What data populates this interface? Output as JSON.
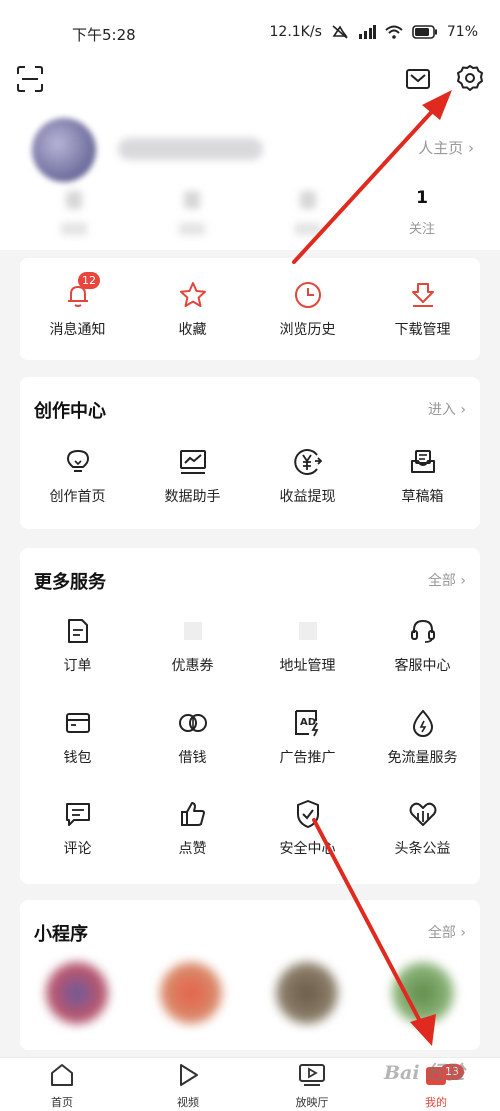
{
  "status_bar": {
    "time": "下午5:28",
    "speed": "12.1K/s",
    "battery": "71%"
  },
  "header": {
    "icons": [
      "scan-icon",
      "mail-icon",
      "gear-icon"
    ]
  },
  "profile": {
    "home_link": "人主页 ›",
    "stats": [
      {
        "value": "1",
        "label": "关注"
      }
    ]
  },
  "quick_actions": [
    {
      "label": "消息通知",
      "icon": "bell-icon",
      "badge": "12"
    },
    {
      "label": "收藏",
      "icon": "star-icon"
    },
    {
      "label": "浏览历史",
      "icon": "clock-icon"
    },
    {
      "label": "下载管理",
      "icon": "download-icon"
    }
  ],
  "creation": {
    "title": "创作中心",
    "more": "进入 ›",
    "items": [
      {
        "label": "创作首页",
        "icon": "bulb-icon"
      },
      {
        "label": "数据助手",
        "icon": "chart-icon"
      },
      {
        "label": "收益提现",
        "icon": "yuan-icon"
      },
      {
        "label": "草稿箱",
        "icon": "draft-icon"
      }
    ]
  },
  "services": {
    "title": "更多服务",
    "more": "全部 ›",
    "items": [
      {
        "label": "订单",
        "icon": "order-icon"
      },
      {
        "label": "优惠券",
        "icon": "coupon-icon"
      },
      {
        "label": "地址管理",
        "icon": "address-icon"
      },
      {
        "label": "客服中心",
        "icon": "headset-icon"
      },
      {
        "label": "钱包",
        "icon": "wallet-icon"
      },
      {
        "label": "借钱",
        "icon": "loan-icon"
      },
      {
        "label": "广告推广",
        "icon": "ad-icon"
      },
      {
        "label": "免流量服务",
        "icon": "data-drop-icon"
      },
      {
        "label": "评论",
        "icon": "comment-icon"
      },
      {
        "label": "点赞",
        "icon": "thumbs-up-icon"
      },
      {
        "label": "安全中心",
        "icon": "shield-icon"
      },
      {
        "label": "头条公益",
        "icon": "charity-icon"
      }
    ]
  },
  "mini_programs": {
    "title": "小程序",
    "more": "全部 ›"
  },
  "tab_bar": {
    "tabs": [
      {
        "label": "首页",
        "icon": "home-icon"
      },
      {
        "label": "视频",
        "icon": "play-icon"
      },
      {
        "label": "放映厅",
        "icon": "tv-icon"
      },
      {
        "label": "我的",
        "icon": "profile-icon",
        "active": true
      }
    ]
  },
  "colors": {
    "accent": "#e2463c",
    "annotation_arrow": "#e02a1f"
  },
  "watermark": "Bai 经验"
}
